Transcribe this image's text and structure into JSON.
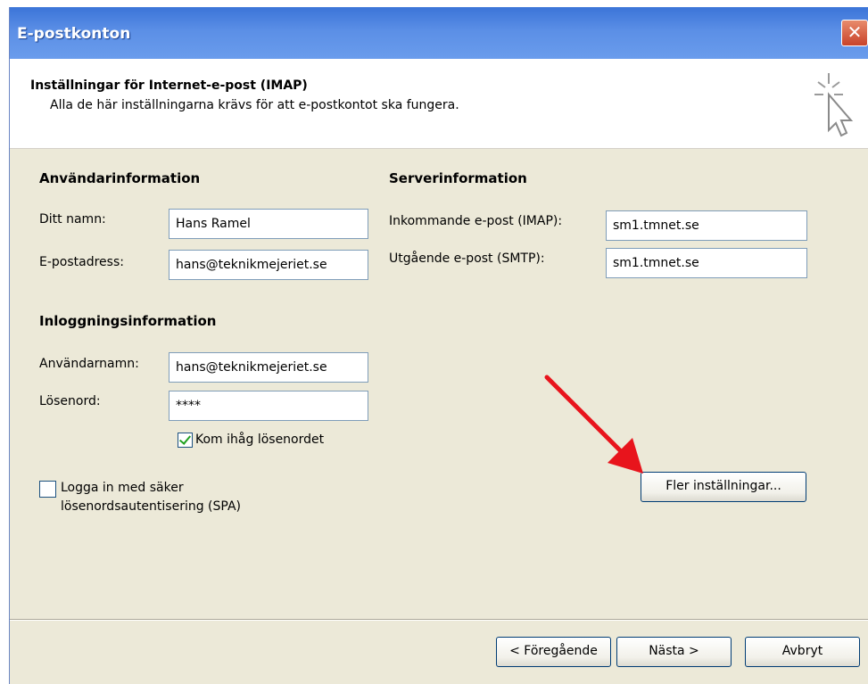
{
  "window": {
    "title": "E-postkonton",
    "close_icon": "close-icon"
  },
  "header": {
    "title": "Inställningar för Internet-e-post (IMAP)",
    "subtitle": "Alla de här inställningarna krävs för att e-postkontot ska fungera.",
    "icon": "cursor-sparkle-icon"
  },
  "user_info": {
    "heading": "Användarinformation",
    "name_label": "Ditt namn:",
    "name_value": "Hans Ramel",
    "email_label": "E-postadress:",
    "email_value": "hans@teknikmejeriet.se"
  },
  "server_info": {
    "heading": "Serverinformation",
    "incoming_label": "Inkommande e-post (IMAP):",
    "incoming_value": "sm1.tmnet.se",
    "outgoing_label": "Utgående e-post (SMTP):",
    "outgoing_value": "sm1.tmnet.se"
  },
  "login_info": {
    "heading": "Inloggningsinformation",
    "username_label": "Användarnamn:",
    "username_value": "hans@teknikmejeriet.se",
    "password_label": "Lösenord:",
    "password_value": "****",
    "remember_label": "Kom ihåg lösenordet",
    "remember_checked": true
  },
  "spa": {
    "label_line1": "Logga in med säker",
    "label_line2": "lösenordsautentisering (SPA)",
    "checked": false
  },
  "buttons": {
    "more_settings": "Fler inställningar...",
    "back": "< Föregående",
    "next": "Nästa >",
    "cancel": "Avbryt"
  },
  "annotation": {
    "arrow_color": "#e8141c"
  }
}
